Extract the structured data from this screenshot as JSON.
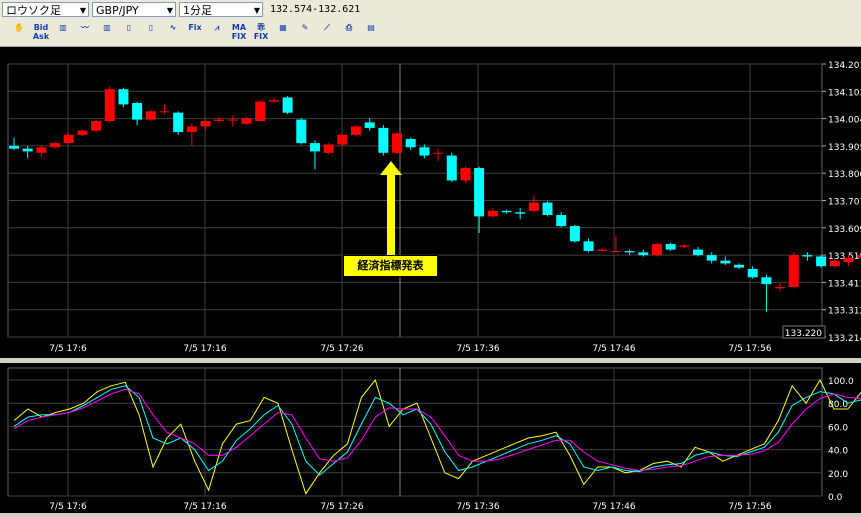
{
  "toolbar": {
    "chart_type": "ロウソク足",
    "pair": "GBP/JPY",
    "timeframe": "1分足",
    "range": "132.574-132.621",
    "icons": [
      {
        "name": "hand-icon",
        "label": "✋"
      },
      {
        "name": "bid-ask-icon",
        "label": "Bid Ask"
      },
      {
        "name": "candle-mode-icon",
        "label": "▥"
      },
      {
        "name": "indicator-icon",
        "label": "〰"
      },
      {
        "name": "bar-chart-icon",
        "label": "▥"
      },
      {
        "name": "candle-chart-icon",
        "label": "▯"
      },
      {
        "name": "candle-chart-alt-icon",
        "label": "▯"
      },
      {
        "name": "line-chart-icon",
        "label": "∿"
      },
      {
        "name": "fix-icon",
        "label": "Fix"
      },
      {
        "name": "wave-fix-icon",
        "label": "⩘"
      },
      {
        "name": "ma-fix-icon",
        "label": "MA FIX"
      },
      {
        "name": "osc-fix-icon",
        "label": "乖 FIX"
      },
      {
        "name": "grid-fix-icon",
        "label": "▦"
      },
      {
        "name": "pencil-icon",
        "label": "✎"
      },
      {
        "name": "trend-icon",
        "label": "⟋"
      },
      {
        "name": "print-icon",
        "label": "⎙"
      },
      {
        "name": "notes-icon",
        "label": "▤"
      }
    ]
  },
  "annotation": {
    "text": "経済指標発表",
    "time": "7/5 17:30"
  },
  "colors": {
    "up": "#ff0000",
    "down": "#00ffff",
    "grid": "#404040",
    "axis_text": "#ffffff",
    "stoch_k": "#ffff00",
    "stoch_d": "#00ffff",
    "stoch_slow": "#ff00ff",
    "arrow": "#ffff00",
    "current_box": "#000000"
  },
  "chart_data": [
    {
      "type": "candlestick",
      "title": "",
      "x_tick_labels": [
        "7/5 17:6",
        "7/5 17:16",
        "7/5 17:26",
        "7/5 17:36",
        "7/5 17:46",
        "7/5 17:56"
      ],
      "y_tick_labels": [
        "134.201",
        "134.103",
        "134.004",
        "133.905",
        "133.806",
        "133.707",
        "133.609",
        "133.510",
        "133.411",
        "133.312",
        "133.214"
      ],
      "ylim": [
        133.214,
        134.201
      ],
      "current_price": "133.220",
      "grid": true,
      "candles": [
        {
          "o": 133.905,
          "h": 133.935,
          "l": 133.89,
          "c": 133.895
        },
        {
          "o": 133.895,
          "h": 133.905,
          "l": 133.86,
          "c": 133.885
        },
        {
          "o": 133.88,
          "h": 133.905,
          "l": 133.865,
          "c": 133.9
        },
        {
          "o": 133.9,
          "h": 133.92,
          "l": 133.895,
          "c": 133.915
        },
        {
          "o": 133.915,
          "h": 133.95,
          "l": 133.91,
          "c": 133.945
        },
        {
          "o": 133.945,
          "h": 133.965,
          "l": 133.94,
          "c": 133.96
        },
        {
          "o": 133.96,
          "h": 134.0,
          "l": 133.955,
          "c": 133.995
        },
        {
          "o": 133.995,
          "h": 134.12,
          "l": 133.99,
          "c": 134.11
        },
        {
          "o": 134.11,
          "h": 134.115,
          "l": 134.045,
          "c": 134.055
        },
        {
          "o": 134.06,
          "h": 134.065,
          "l": 133.98,
          "c": 134.0
        },
        {
          "o": 134.0,
          "h": 134.035,
          "l": 133.995,
          "c": 134.03
        },
        {
          "o": 134.03,
          "h": 134.055,
          "l": 134.02,
          "c": 134.03
        },
        {
          "o": 134.025,
          "h": 134.03,
          "l": 133.945,
          "c": 133.955
        },
        {
          "o": 133.955,
          "h": 133.985,
          "l": 133.905,
          "c": 133.975
        },
        {
          "o": 133.975,
          "h": 134.0,
          "l": 133.96,
          "c": 133.995
        },
        {
          "o": 133.995,
          "h": 134.01,
          "l": 133.99,
          "c": 134.0
        },
        {
          "o": 134.0,
          "h": 134.015,
          "l": 133.975,
          "c": 134.0
        },
        {
          "o": 133.985,
          "h": 134.01,
          "l": 133.98,
          "c": 134.005
        },
        {
          "o": 133.995,
          "h": 134.07,
          "l": 133.995,
          "c": 134.065
        },
        {
          "o": 134.065,
          "h": 134.08,
          "l": 134.06,
          "c": 134.07
        },
        {
          "o": 134.08,
          "h": 134.085,
          "l": 134.02,
          "c": 134.025
        },
        {
          "o": 134.0,
          "h": 134.005,
          "l": 133.91,
          "c": 133.915
        },
        {
          "o": 133.915,
          "h": 133.925,
          "l": 133.82,
          "c": 133.885
        },
        {
          "o": 133.88,
          "h": 133.915,
          "l": 133.875,
          "c": 133.91
        },
        {
          "o": 133.91,
          "h": 133.95,
          "l": 133.905,
          "c": 133.945
        },
        {
          "o": 133.945,
          "h": 133.98,
          "l": 133.94,
          "c": 133.975
        },
        {
          "o": 133.99,
          "h": 134.005,
          "l": 133.96,
          "c": 133.97
        },
        {
          "o": 133.97,
          "h": 133.98,
          "l": 133.87,
          "c": 133.88
        },
        {
          "o": 133.88,
          "h": 133.955,
          "l": 133.875,
          "c": 133.95
        },
        {
          "o": 133.93,
          "h": 133.935,
          "l": 133.89,
          "c": 133.9
        },
        {
          "o": 133.9,
          "h": 133.91,
          "l": 133.86,
          "c": 133.87
        },
        {
          "o": 133.88,
          "h": 133.895,
          "l": 133.85,
          "c": 133.88
        },
        {
          "o": 133.87,
          "h": 133.88,
          "l": 133.775,
          "c": 133.78
        },
        {
          "o": 133.78,
          "h": 133.83,
          "l": 133.77,
          "c": 133.825
        },
        {
          "o": 133.825,
          "h": 133.83,
          "l": 133.59,
          "c": 133.65
        },
        {
          "o": 133.65,
          "h": 133.68,
          "l": 133.645,
          "c": 133.67
        },
        {
          "o": 133.67,
          "h": 133.675,
          "l": 133.66,
          "c": 133.665
        },
        {
          "o": 133.665,
          "h": 133.68,
          "l": 133.64,
          "c": 133.66
        },
        {
          "o": 133.67,
          "h": 133.725,
          "l": 133.665,
          "c": 133.7
        },
        {
          "o": 133.7,
          "h": 133.705,
          "l": 133.65,
          "c": 133.655
        },
        {
          "o": 133.655,
          "h": 133.665,
          "l": 133.61,
          "c": 133.615
        },
        {
          "o": 133.615,
          "h": 133.62,
          "l": 133.555,
          "c": 133.56
        },
        {
          "o": 133.56,
          "h": 133.57,
          "l": 133.52,
          "c": 133.525
        },
        {
          "o": 133.525,
          "h": 133.535,
          "l": 133.525,
          "c": 133.53
        },
        {
          "o": 133.525,
          "h": 133.58,
          "l": 133.52,
          "c": 133.525
        },
        {
          "o": 133.525,
          "h": 133.53,
          "l": 133.51,
          "c": 133.52
        },
        {
          "o": 133.52,
          "h": 133.53,
          "l": 133.505,
          "c": 133.51
        },
        {
          "o": 133.51,
          "h": 133.555,
          "l": 133.505,
          "c": 133.55
        },
        {
          "o": 133.55,
          "h": 133.555,
          "l": 133.525,
          "c": 133.53
        },
        {
          "o": 133.54,
          "h": 133.55,
          "l": 133.535,
          "c": 133.545
        },
        {
          "o": 133.53,
          "h": 133.54,
          "l": 133.505,
          "c": 133.51
        },
        {
          "o": 133.51,
          "h": 133.52,
          "l": 133.48,
          "c": 133.49
        },
        {
          "o": 133.49,
          "h": 133.505,
          "l": 133.475,
          "c": 133.48
        },
        {
          "o": 133.475,
          "h": 133.48,
          "l": 133.46,
          "c": 133.465
        },
        {
          "o": 133.46,
          "h": 133.47,
          "l": 133.425,
          "c": 133.43
        },
        {
          "o": 133.43,
          "h": 133.44,
          "l": 133.305,
          "c": 133.405
        },
        {
          "o": 133.39,
          "h": 133.41,
          "l": 133.38,
          "c": 133.395
        },
        {
          "o": 133.395,
          "h": 133.52,
          "l": 133.39,
          "c": 133.51
        },
        {
          "o": 133.51,
          "h": 133.52,
          "l": 133.49,
          "c": 133.505
        },
        {
          "o": 133.505,
          "h": 133.51,
          "l": 133.465,
          "c": 133.47
        },
        {
          "o": 133.47,
          "h": 133.495,
          "l": 133.465,
          "c": 133.49
        },
        {
          "o": 133.485,
          "h": 133.51,
          "l": 133.47,
          "c": 133.5
        },
        {
          "o": 133.5,
          "h": 133.52,
          "l": 133.49,
          "c": 133.51
        },
        {
          "o": 133.505,
          "h": 133.52,
          "l": 133.495,
          "c": 133.51
        },
        {
          "o": 133.505,
          "h": 133.55,
          "l": 133.505,
          "c": 133.545
        }
      ]
    },
    {
      "type": "line",
      "title": "",
      "x_tick_labels": [
        "7/5 17:6",
        "7/5 17:16",
        "7/5 17:26",
        "7/5 17:36",
        "7/5 17:46",
        "7/5 17:56"
      ],
      "y_tick_labels": [
        "100.0",
        "80.0",
        "60.0",
        "40.0",
        "20.0",
        "0.0"
      ],
      "ylim": [
        0,
        100
      ],
      "grid": true,
      "series": [
        {
          "values": [
            65,
            75,
            68,
            72,
            75,
            80,
            90,
            95,
            98,
            70,
            25,
            50,
            62,
            30,
            5,
            45,
            62,
            65,
            85,
            80,
            40,
            2,
            20,
            35,
            45,
            85,
            100,
            60,
            75,
            80,
            50,
            20,
            15,
            30,
            35,
            40,
            45,
            50,
            52,
            55,
            35,
            10,
            25,
            25,
            20,
            22,
            28,
            30,
            25,
            42,
            38,
            30,
            35,
            40,
            45,
            65,
            95,
            80,
            100,
            75,
            75,
            90,
            95,
            98
          ]
        },
        {
          "values": [
            60,
            68,
            70,
            70,
            72,
            78,
            85,
            92,
            95,
            85,
            50,
            45,
            50,
            40,
            22,
            30,
            48,
            58,
            70,
            78,
            62,
            30,
            18,
            28,
            38,
            62,
            85,
            80,
            70,
            75,
            62,
            38,
            22,
            25,
            30,
            35,
            40,
            45,
            48,
            52,
            45,
            25,
            22,
            25,
            22,
            21,
            25,
            27,
            28,
            35,
            38,
            35,
            34,
            38,
            42,
            55,
            78,
            85,
            90,
            88,
            80,
            83,
            90,
            95
          ]
        },
        {
          "values": [
            58,
            65,
            68,
            70,
            72,
            76,
            82,
            88,
            92,
            88,
            70,
            55,
            50,
            45,
            35,
            35,
            42,
            52,
            62,
            72,
            70,
            50,
            32,
            30,
            33,
            48,
            68,
            76,
            75,
            75,
            68,
            52,
            35,
            30,
            30,
            32,
            36,
            40,
            44,
            48,
            48,
            38,
            30,
            27,
            24,
            22,
            23,
            25,
            26,
            30,
            34,
            35,
            35,
            36,
            39,
            46,
            62,
            75,
            84,
            88,
            85,
            84,
            86,
            90
          ]
        }
      ]
    }
  ]
}
